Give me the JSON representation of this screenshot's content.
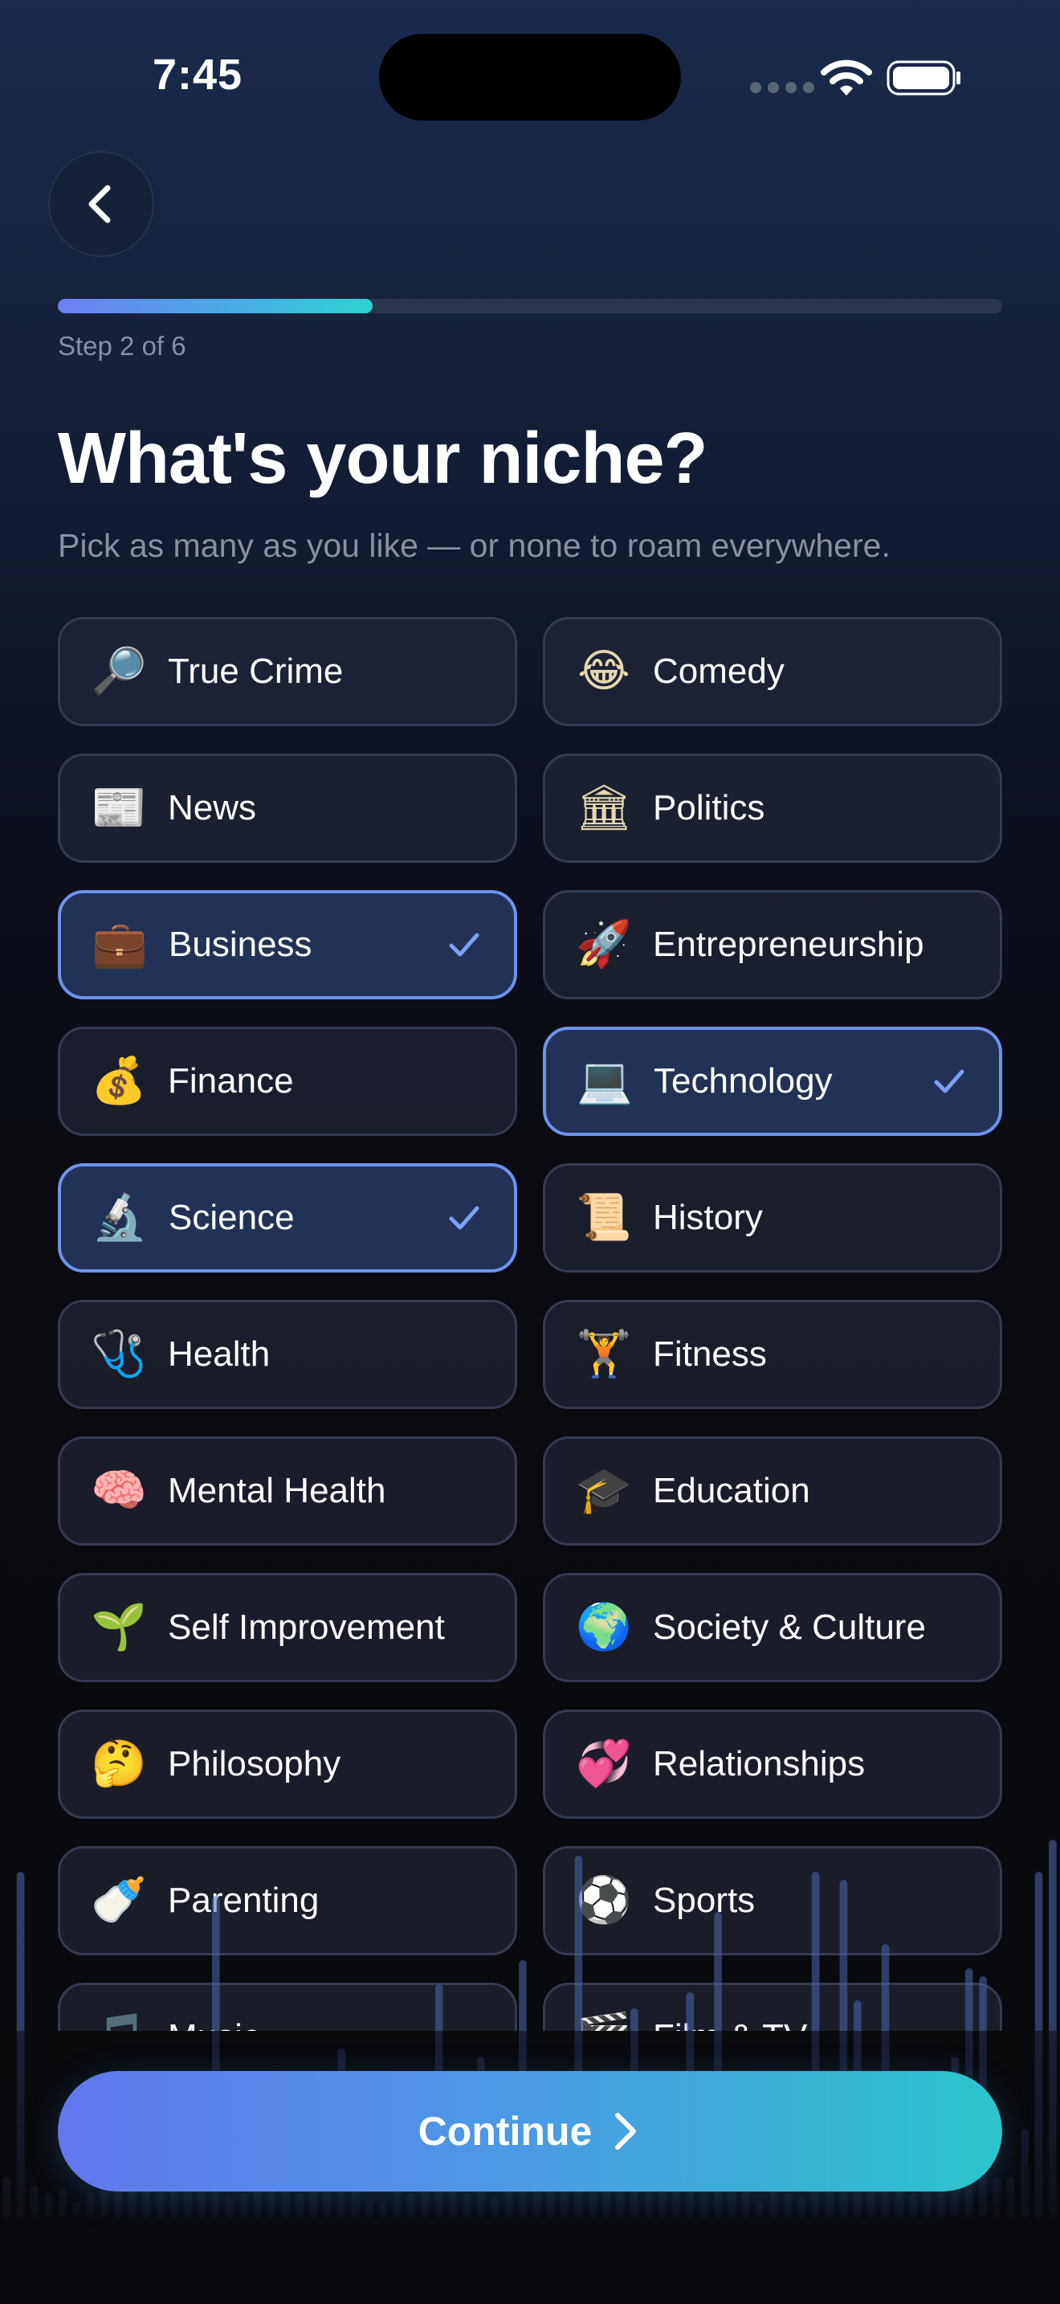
{
  "status_bar": {
    "time": "7:45"
  },
  "header": {
    "back_icon": "chevron-left-icon",
    "step_label": "Step 2 of 6",
    "progress": 0.333
  },
  "title": "What's your niche?",
  "subtitle": "Pick as many as you like — or none to roam everywhere.",
  "niches": [
    {
      "label": "True Crime",
      "icon": "🔎",
      "selected": false
    },
    {
      "label": "Comedy",
      "icon": "😂",
      "selected": false
    },
    {
      "label": "News",
      "icon": "📰",
      "selected": false
    },
    {
      "label": "Politics",
      "icon": "🏛",
      "selected": false
    },
    {
      "label": "Business",
      "icon": "💼",
      "selected": true
    },
    {
      "label": "Entrepreneurship",
      "icon": "🚀",
      "selected": false
    },
    {
      "label": "Finance",
      "icon": "💰",
      "selected": false
    },
    {
      "label": "Technology",
      "icon": "💻",
      "selected": true
    },
    {
      "label": "Science",
      "icon": "🔬",
      "selected": true
    },
    {
      "label": "History",
      "icon": "📜",
      "selected": false
    },
    {
      "label": "Health",
      "icon": "🩺",
      "selected": false
    },
    {
      "label": "Fitness",
      "icon": "🏋",
      "selected": false
    },
    {
      "label": "Mental Health",
      "icon": "🧠",
      "selected": false
    },
    {
      "label": "Education",
      "icon": "🎓",
      "selected": false
    },
    {
      "label": "Self Improvement",
      "icon": "🌱",
      "selected": false
    },
    {
      "label": "Society & Culture",
      "icon": "🌍",
      "selected": false
    },
    {
      "label": "Philosophy",
      "icon": "🤔",
      "selected": false
    },
    {
      "label": "Relationships",
      "icon": "💞",
      "selected": false
    },
    {
      "label": "Parenting",
      "icon": "🍼",
      "selected": false
    },
    {
      "label": "Sports",
      "icon": "⚽",
      "selected": false
    },
    {
      "label": "Music",
      "icon": "🎵",
      "selected": false
    },
    {
      "label": "Film & TV",
      "icon": "🎬",
      "selected": false
    }
  ],
  "continue_button": {
    "label": "Continue",
    "icon": "chevron-right-icon"
  },
  "colors": {
    "accent_start": "#6277ef",
    "accent_end": "#2cc5cb",
    "selected_border": "#6c93ee",
    "check": "#7ba2f5"
  }
}
